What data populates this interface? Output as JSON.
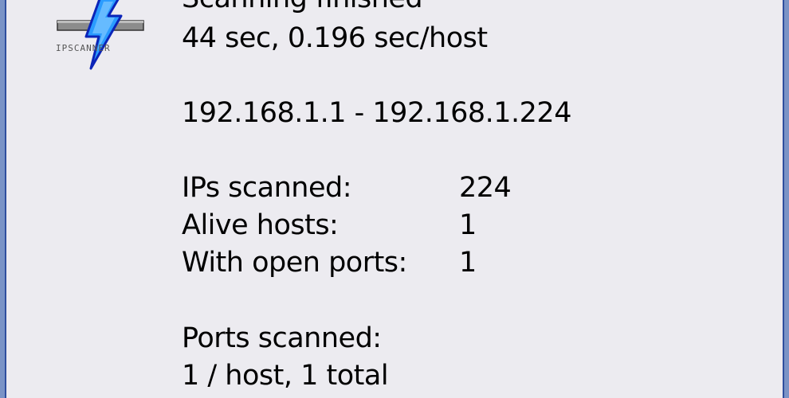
{
  "dialog": {
    "status": "Scanning finished",
    "duration": "44 sec,  0.196 sec/host",
    "range": "192.168.1.1 - 192.168.1.224",
    "stats": [
      {
        "label": "IPs scanned:",
        "value": "224"
      },
      {
        "label": "Alive hosts:",
        "value": "1"
      },
      {
        "label": "With open ports:",
        "value": "1"
      }
    ],
    "ports_label": "Ports scanned:",
    "ports_value": "1 / host,  1 total"
  },
  "logo": {
    "icon": "ipscanner-lightning-icon",
    "text": "IPSCANNER",
    "colors": {
      "bolt": "#2a9cff",
      "bolt_outline": "#0b24b8",
      "bar": "#8c8c8c"
    }
  }
}
